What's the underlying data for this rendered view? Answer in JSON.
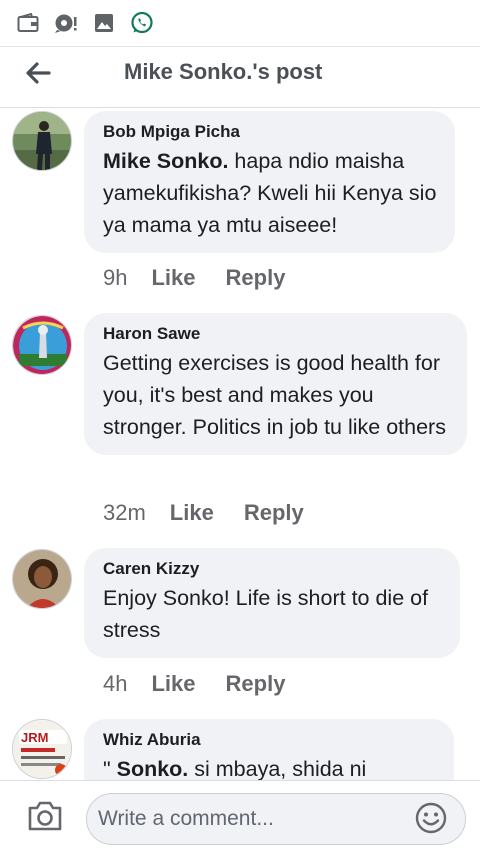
{
  "status_bar": {
    "icons": [
      "wallet-card-icon",
      "chat-alert-icon",
      "gallery-icon",
      "whatsapp-icon"
    ]
  },
  "header": {
    "back_icon": "back-arrow-icon",
    "title": "Mike Sonko.'s post"
  },
  "comments": [
    {
      "author": "Bob Mpiga Picha",
      "mention": "Mike Sonko.",
      "text": " hapa ndio maisha yamekufikisha? Kweli hii Kenya sio ya mama ya mtu aiseee!",
      "time": "9h",
      "like_label": "Like",
      "reply_label": "Reply"
    },
    {
      "author": "Haron Sawe",
      "mention": "",
      "text": "Getting exercises is good health for you, it's best and makes you stronger. Politics in job tu like others",
      "time": "32m",
      "like_label": "Like",
      "reply_label": "Reply"
    },
    {
      "author": "Caren Kizzy",
      "mention": "",
      "text": "Enjoy Sonko! Life is short to die of stress",
      "time": "4h",
      "like_label": "Like",
      "reply_label": "Reply"
    },
    {
      "author": "Whiz Aburia",
      "prefix": "\" ",
      "mention": "Sonko.",
      "text": " si mbaya, shida ni",
      "avatar_text": "JRM"
    }
  ],
  "composer": {
    "camera_icon": "camera-icon",
    "placeholder": "Write a comment...",
    "emoji_icon": "emoji-smile-icon"
  },
  "colors": {
    "bubble": "#f0f2f5",
    "secondary_text": "#65676b",
    "title_text": "#4b4f56",
    "whatsapp": "#25d366"
  }
}
